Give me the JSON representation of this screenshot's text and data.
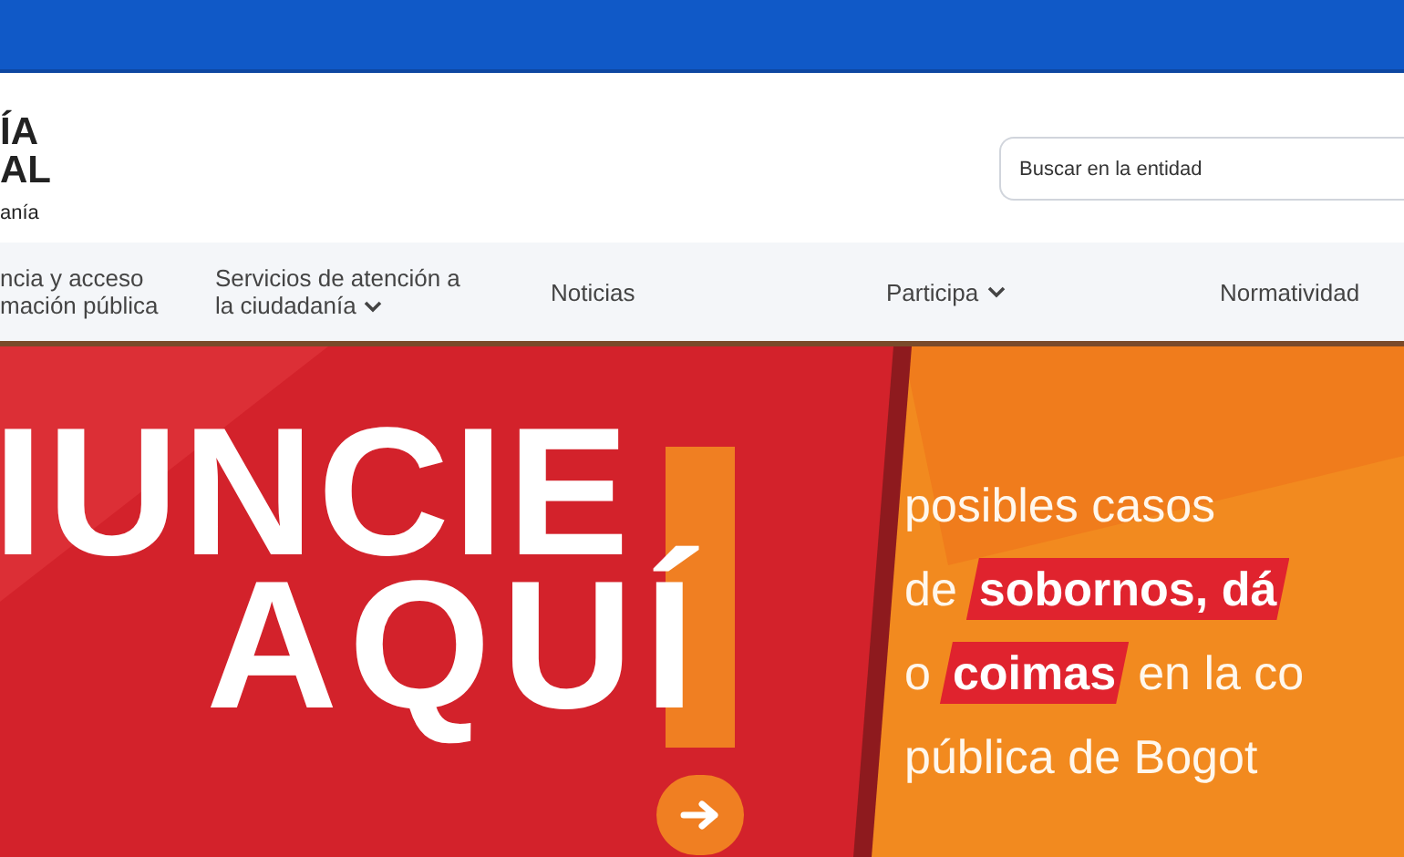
{
  "logo": {
    "lines": [
      "ÍA",
      "AL"
    ],
    "tagline": "anía"
  },
  "search": {
    "placeholder": "Buscar en la entidad"
  },
  "nav": [
    {
      "lines": [
        "ncia y acceso",
        "mación pública"
      ],
      "dropdown": false
    },
    {
      "lines": [
        "Servicios de atención a",
        "la ciudadanía"
      ],
      "dropdown": true
    },
    {
      "lines": [
        "Noticias"
      ],
      "dropdown": false
    },
    {
      "lines": [
        "Participa"
      ],
      "dropdown": true
    },
    {
      "lines": [
        "Normatividad"
      ],
      "dropdown": false
    }
  ],
  "banner": {
    "headline": [
      "IUNCIE",
      "AQUÍ"
    ],
    "message": [
      [
        {
          "text": "posibles casos",
          "highlight": false
        }
      ],
      [
        {
          "text": "de",
          "highlight": false
        },
        {
          "text": "sobornos,  dá",
          "highlight": true
        }
      ],
      [
        {
          "text": "o",
          "highlight": false
        },
        {
          "text": "coimas",
          "highlight": true
        },
        {
          "text": "en la co",
          "highlight": false
        }
      ],
      [
        {
          "text": "pública de Bogot",
          "highlight": false
        }
      ]
    ]
  }
}
